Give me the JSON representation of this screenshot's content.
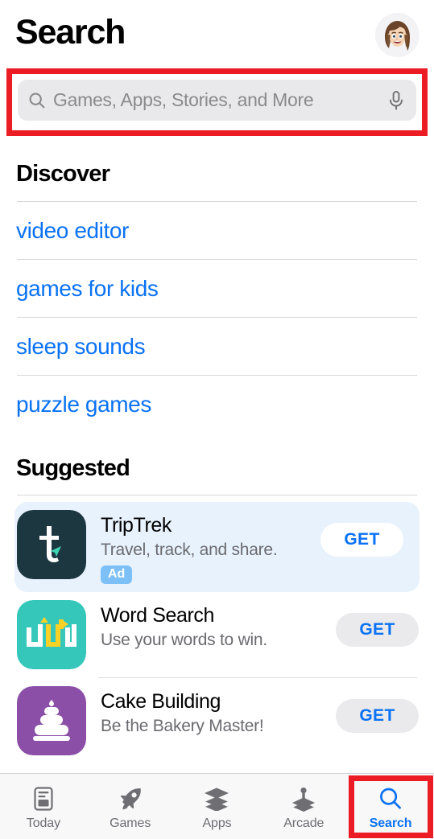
{
  "header": {
    "title": "Search",
    "avatar_name": "user-memoji-avatar"
  },
  "search": {
    "placeholder": "Games, Apps, Stories, and More",
    "value": "",
    "search_icon": "magnifier-icon",
    "mic_icon": "microphone-icon",
    "highlight_color": "#ec1c24"
  },
  "discover": {
    "title": "Discover",
    "items": [
      {
        "label": "video editor"
      },
      {
        "label": "games for kids"
      },
      {
        "label": "sleep sounds"
      },
      {
        "label": "puzzle games"
      }
    ],
    "link_color": "#0a72f5"
  },
  "suggested": {
    "title": "Suggested",
    "apps": [
      {
        "name": "TripTrek",
        "subtitle": "Travel, track, and share.",
        "badge": "Ad",
        "action": "GET",
        "icon": "triptrek-app-icon",
        "is_ad": true
      },
      {
        "name": "Word Search",
        "subtitle": "Use your words to win.",
        "badge": "",
        "action": "GET",
        "icon": "wordsearch-app-icon",
        "is_ad": false
      },
      {
        "name": "Cake Building",
        "subtitle": "Be the Bakery Master!",
        "badge": "",
        "action": "GET",
        "icon": "cakebuilding-app-icon",
        "is_ad": false
      }
    ]
  },
  "tabbar": {
    "tabs": [
      {
        "label": "Today",
        "icon": "today-document-icon",
        "active": false
      },
      {
        "label": "Games",
        "icon": "rocket-icon",
        "active": false
      },
      {
        "label": "Apps",
        "icon": "stacked-layers-icon",
        "active": false
      },
      {
        "label": "Arcade",
        "icon": "joystick-icon",
        "active": false
      },
      {
        "label": "Search",
        "icon": "magnifier-icon",
        "active": true
      }
    ],
    "active_color": "#0a72f5",
    "inactive_color": "#6e6e73"
  }
}
